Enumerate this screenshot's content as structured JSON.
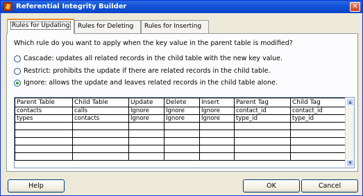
{
  "window": {
    "title": "Referential Integrity Builder",
    "close_glyph": "✕",
    "accent": "#0a45c8"
  },
  "tabs": [
    {
      "label": "Rules for Updating",
      "active": true
    },
    {
      "label": "Rules for Deleting",
      "active": false
    },
    {
      "label": "Rules for Inserting",
      "active": false
    }
  ],
  "panel": {
    "question": "Which rule do you want to apply when the key value in the parent table is modified?",
    "options": [
      {
        "label": "Cascade: updates all related records in the child table with the new key value.",
        "checked": false
      },
      {
        "label": "Restrict: prohibits the update if there are related records in the child table.",
        "checked": false
      },
      {
        "label": "Ignore: allows the update and leaves related records in the child table alone.",
        "checked": true
      }
    ]
  },
  "grid": {
    "columns": [
      "Parent Table",
      "Child Table",
      "Update",
      "Delete",
      "Insert",
      "Parent Tag",
      "Child Tag"
    ],
    "rows": [
      [
        "contacts",
        "calls",
        "Ignore",
        "Ignore",
        "Ignore",
        "contact_id",
        "contact_id"
      ],
      [
        "types",
        "contacts",
        "Ignore",
        "Ignore",
        "Ignore",
        "type_id",
        "type_id"
      ],
      [
        "",
        "",
        "",
        "",
        "",
        "",
        ""
      ],
      [
        "",
        "",
        "",
        "",
        "",
        "",
        ""
      ],
      [
        "",
        "",
        "",
        "",
        "",
        "",
        ""
      ],
      [
        "",
        "",
        "",
        "",
        "",
        "",
        ""
      ],
      [
        "",
        "",
        "",
        "",
        "",
        "",
        ""
      ]
    ]
  },
  "buttons": {
    "help": "Help",
    "ok": "OK",
    "cancel": "Cancel"
  }
}
